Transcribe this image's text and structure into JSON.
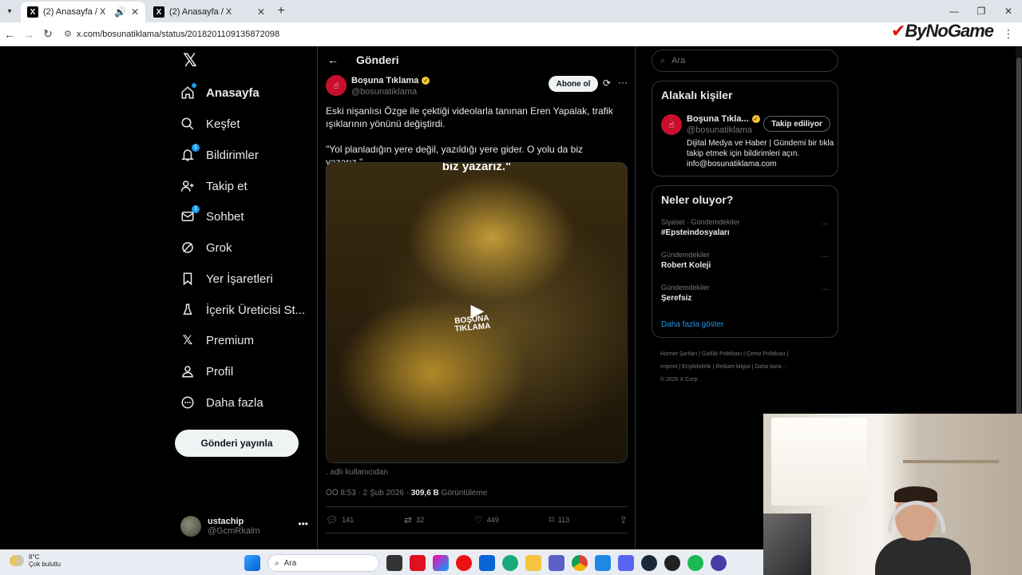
{
  "browser": {
    "tabs": [
      {
        "title": "(2) Anasayfa / X",
        "active": true
      },
      {
        "title": "(2) Anasayfa / X",
        "active": false
      }
    ],
    "url": "x.com/bosunatiklama/status/2018201109135872098",
    "overlay_logo": "ByNoGame"
  },
  "sidebar": {
    "items": [
      {
        "label": "Anasayfa",
        "icon": "home-icon"
      },
      {
        "label": "Keşfet",
        "icon": "search-icon"
      },
      {
        "label": "Bildirimler",
        "icon": "bell-icon",
        "badge": "1"
      },
      {
        "label": "Takip et",
        "icon": "person-add-icon"
      },
      {
        "label": "Sohbet",
        "icon": "mail-icon",
        "badge": "1"
      },
      {
        "label": "Grok",
        "icon": "grok-icon"
      },
      {
        "label": "Yer İşaretleri",
        "icon": "bookmark-icon"
      },
      {
        "label": "İçerik Üreticisi St...",
        "icon": "creator-icon"
      },
      {
        "label": "Premium",
        "icon": "x-premium-icon"
      },
      {
        "label": "Profil",
        "icon": "person-icon"
      },
      {
        "label": "Daha fazla",
        "icon": "more-circle-icon"
      }
    ],
    "post_button": "Gönderi yayınla",
    "account": {
      "name": "ustachip",
      "handle": "@GcmRkalm"
    }
  },
  "post": {
    "header_title": "Gönderi",
    "author_name": "Boşuna Tıklama",
    "author_handle": "@bosunatiklama",
    "subscribe_label": "Abone ol",
    "text_1": "Eski nişanlısı Özge ile çektiği videolarla tanınan Eren Yapalak, trafik ışıklarının yönünü değiştirdi.",
    "text_2": "\"Yol planladığın yere değil, yazıldığı yere gider. O yolu da biz yazarız.\"",
    "video_caption": "biz yazarız.\"",
    "video_watermark_1": "BOŞUNA",
    "video_watermark_2": "TIKLAMA",
    "alt_line": ". adlı kullanıcıdan",
    "time": "ÖÖ 8:53 · 2 Şub 2026 · ",
    "views_count": "309,6 B",
    "views_label": " Görüntüleme",
    "stats": {
      "replies": "141",
      "reposts": "32",
      "likes": "449",
      "bookmarks": "113"
    }
  },
  "right": {
    "search_placeholder": "Ara",
    "related_title": "Alakalı kişiler",
    "related": {
      "name": "Boşuna Tıkla...",
      "handle": "@bosunatiklama",
      "follow_label": "Takip ediliyor",
      "bio": "Dijital Medya ve Haber | Gündemi bir tıkla takip etmek için bildirimleri açın. info@bosunatiklama.com"
    },
    "trends_title": "Neler oluyor?",
    "trends": [
      {
        "category": "Siyaset · Gündemdekiler",
        "title": "#Epsteindosyaları"
      },
      {
        "category": "Gündemdekiler",
        "title": "Robert Koleji"
      },
      {
        "category": "Gündemdekiler",
        "title": "Şerefsiz"
      }
    ],
    "show_more": "Daha fazla göster",
    "footer_1": "Hizmet Şartları  |  Gizlilik Politikası  |  Çerez Politikası  |",
    "footer_2": "Imprint  |  Erişilebilirlik  |  Reklam bilgisi  |  Daha fazla ···",
    "footer_3": "© 2026 X Corp."
  },
  "taskbar": {
    "temp": "8°C",
    "weather": "Çok bulutlu",
    "search": "Ara"
  }
}
